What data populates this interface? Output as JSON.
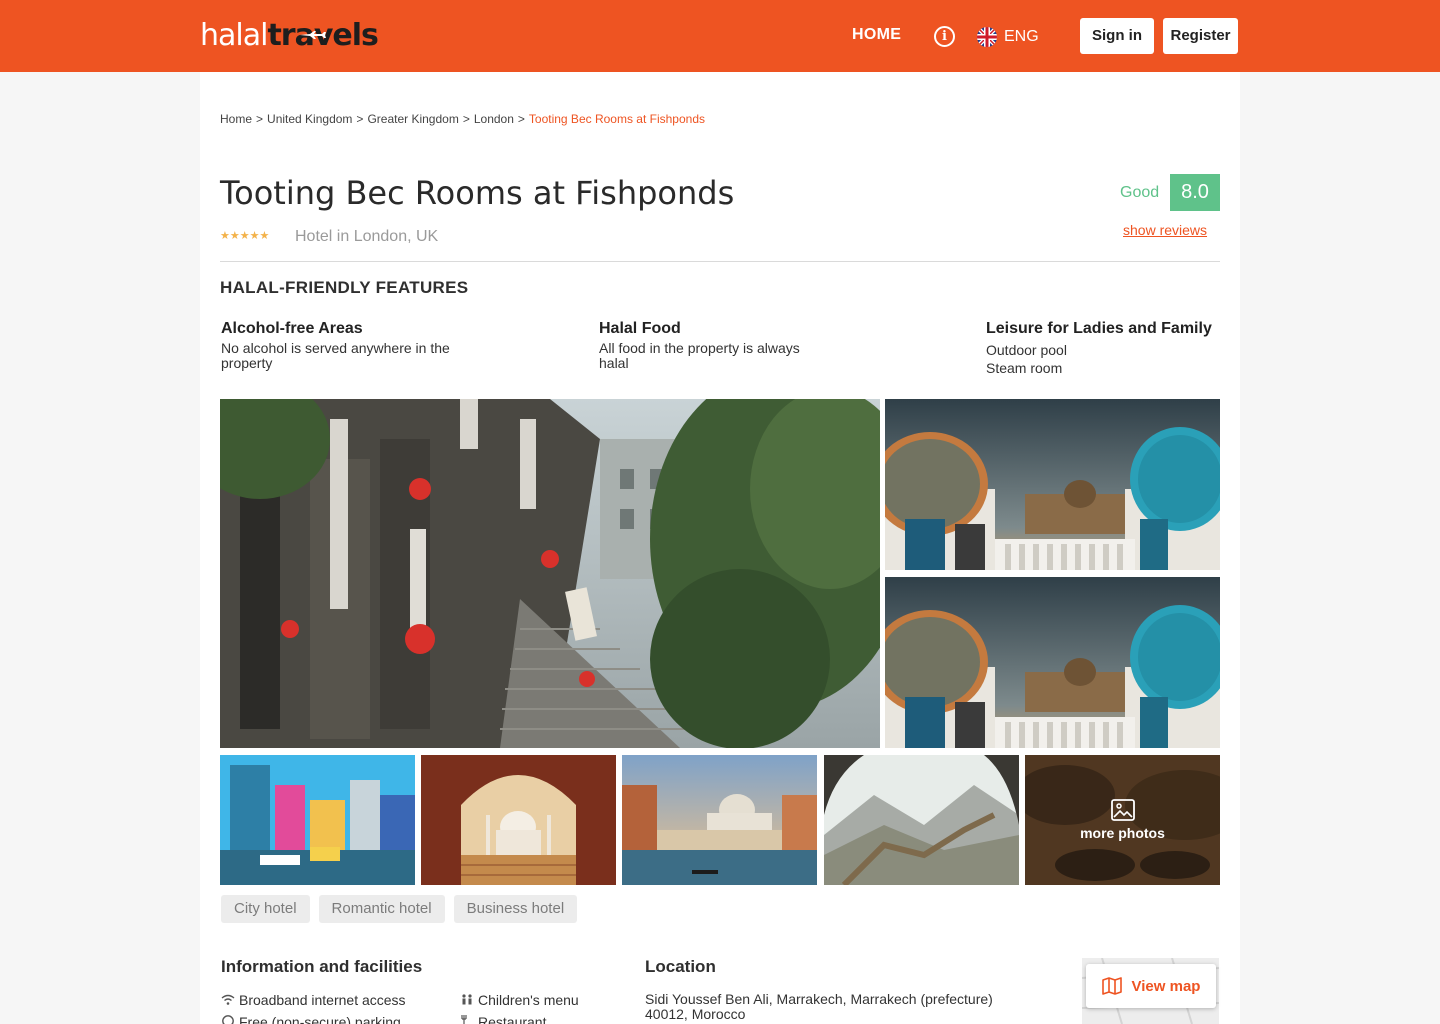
{
  "header": {
    "logo_part1": "halal",
    "logo_part2": "travels",
    "home": "HOME",
    "info_icon": "info-icon",
    "language": "ENG",
    "sign_in": "Sign in",
    "register": "Register",
    "brand_color": "#ee5422"
  },
  "breadcrumb": {
    "items": [
      "Home",
      "United Kingdom",
      "Greater Kingdom",
      "London"
    ],
    "separator": ">",
    "current": "Tooting Bec Rooms at Fishponds"
  },
  "hotel": {
    "name": "Tooting Bec Rooms at Fishponds",
    "stars": 5,
    "stars_text": "★★★★★",
    "subtitle": "Hotel in London, UK",
    "rating_label": "Good",
    "rating": "8.0",
    "rating_color": "#5fc28a",
    "reviews_link": "show  reviews"
  },
  "features": {
    "heading": "HALAL-FRIENDLY FEATURES",
    "items": [
      {
        "title": "Alcohol-free Areas",
        "lines": [
          "No alcohol is served anywhere in the",
          "property"
        ]
      },
      {
        "title": "Halal Food",
        "lines": [
          "All food in the property is always",
          "halal"
        ]
      },
      {
        "title": "Leisure for Ladies and Family",
        "lines": [
          "Outdoor pool",
          "Steam room"
        ]
      }
    ]
  },
  "gallery": {
    "more_label": "more photos",
    "more_icon": "image-icon"
  },
  "tags": [
    "City hotel",
    "Romantic hotel",
    "Business hotel"
  ],
  "facilities": {
    "heading": "Information and facilities",
    "items": [
      {
        "label": "Broadband internet access",
        "icon": "wifi-icon"
      },
      {
        "label": "Children's menu",
        "icon": "children-icon"
      },
      {
        "label": "Free (non-secure) parking",
        "icon": "parking-icon"
      },
      {
        "label": "Restaurant",
        "icon": "restaurant-icon"
      }
    ]
  },
  "location": {
    "heading": "Location",
    "line1": "Sidi Youssef Ben Ali, Marrakech, Marrakech (prefecture)",
    "line2": "40012, Morocco",
    "view_map": "View map",
    "map_icon": "map-icon"
  }
}
